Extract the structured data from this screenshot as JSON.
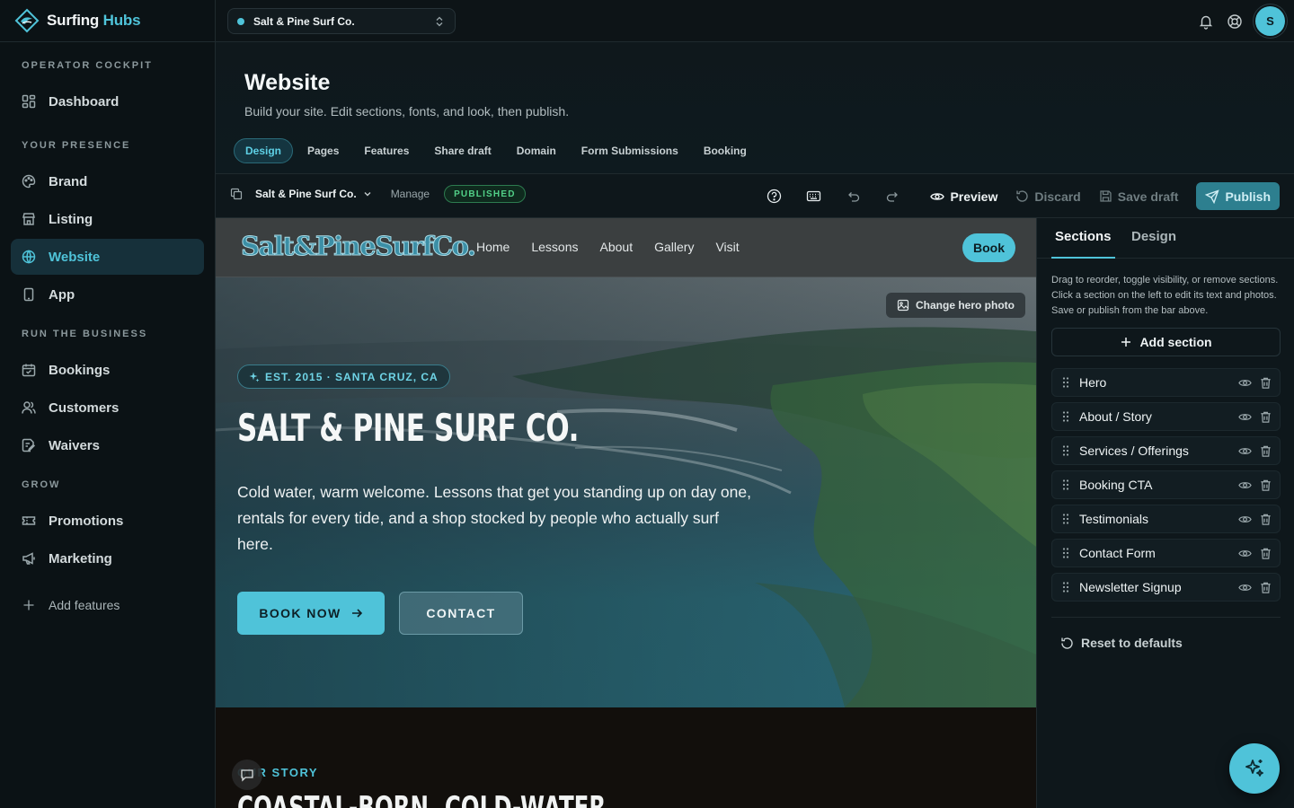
{
  "app": {
    "name_part1": "Surfing",
    "name_part2": "Hubs",
    "org": "Salt & Pine Surf Co.",
    "user_initial": "S"
  },
  "sidebar": {
    "sections": [
      {
        "heading": "OPERATOR COCKPIT",
        "items": [
          {
            "label": "Dashboard",
            "icon": "dashboard-icon"
          }
        ]
      },
      {
        "heading": "YOUR PRESENCE",
        "items": [
          {
            "label": "Brand",
            "icon": "palette-icon"
          },
          {
            "label": "Listing",
            "icon": "store-icon"
          },
          {
            "label": "Website",
            "icon": "globe-icon",
            "active": true
          },
          {
            "label": "App",
            "icon": "phone-icon"
          }
        ]
      },
      {
        "heading": "RUN THE BUSINESS",
        "items": [
          {
            "label": "Bookings",
            "icon": "calendar-icon"
          },
          {
            "label": "Customers",
            "icon": "users-icon"
          },
          {
            "label": "Waivers",
            "icon": "document-sign-icon"
          }
        ]
      },
      {
        "heading": "GROW",
        "items": [
          {
            "label": "Promotions",
            "icon": "ticket-icon"
          },
          {
            "label": "Marketing",
            "icon": "megaphone-icon"
          }
        ]
      }
    ],
    "add_features": "Add features"
  },
  "page": {
    "title": "Website",
    "subtitle": "Build your site. Edit sections, fonts, and look, then publish.",
    "tabs": [
      "Design",
      "Pages",
      "Features",
      "Share draft",
      "Domain",
      "Form Submissions",
      "Booking"
    ],
    "active_tab": "Design"
  },
  "toolbar": {
    "site": "Salt & Pine Surf Co.",
    "manage": "Manage",
    "status": "PUBLISHED",
    "preview": "Preview",
    "discard": "Discard",
    "save_draft": "Save draft",
    "publish": "Publish"
  },
  "preview": {
    "logo": "Salt&PineSurfCo.",
    "nav_links": [
      "Home",
      "Lessons",
      "About",
      "Gallery",
      "Visit"
    ],
    "book": "Book",
    "change_photo": "Change hero photo",
    "badge": "EST. 2015 · SANTA CRUZ, CA",
    "hero_title": "SALT & PINE SURF CO.",
    "hero_desc": "Cold water, warm welcome. Lessons that get you standing up on day one, rentals for every tide, and a shop stocked by people who actually surf here.",
    "cta_primary": "BOOK NOW",
    "cta_secondary": "CONTACT",
    "story_kicker": "OUR STORY",
    "story_title": "COASTAL-BORN, COLD-WATER"
  },
  "panel": {
    "tabs": [
      "Sections",
      "Design"
    ],
    "help": "Drag to reorder, toggle visibility, or remove sections. Click a section on the left to edit its text and photos. Save or publish from the bar above.",
    "add_section": "Add section",
    "sections": [
      "Hero",
      "About / Story",
      "Services / Offerings",
      "Booking CTA",
      "Testimonials",
      "Contact Form",
      "Newsletter Signup"
    ],
    "reset": "Reset to defaults"
  },
  "colors": {
    "accent": "#4fc3d9",
    "published": "#52d188",
    "background": "#0d1417"
  }
}
